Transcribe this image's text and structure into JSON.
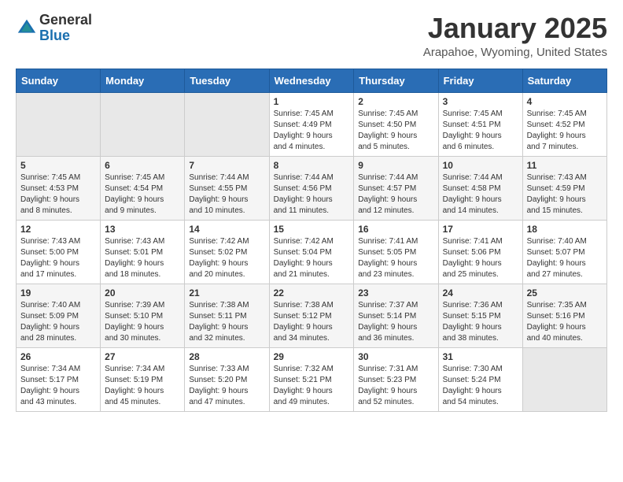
{
  "header": {
    "logo_general": "General",
    "logo_blue": "Blue",
    "month_title": "January 2025",
    "location": "Arapahoe, Wyoming, United States"
  },
  "weekdays": [
    "Sunday",
    "Monday",
    "Tuesday",
    "Wednesday",
    "Thursday",
    "Friday",
    "Saturday"
  ],
  "weeks": [
    [
      {
        "day": "",
        "info": ""
      },
      {
        "day": "",
        "info": ""
      },
      {
        "day": "",
        "info": ""
      },
      {
        "day": "1",
        "info": "Sunrise: 7:45 AM\nSunset: 4:49 PM\nDaylight: 9 hours\nand 4 minutes."
      },
      {
        "day": "2",
        "info": "Sunrise: 7:45 AM\nSunset: 4:50 PM\nDaylight: 9 hours\nand 5 minutes."
      },
      {
        "day": "3",
        "info": "Sunrise: 7:45 AM\nSunset: 4:51 PM\nDaylight: 9 hours\nand 6 minutes."
      },
      {
        "day": "4",
        "info": "Sunrise: 7:45 AM\nSunset: 4:52 PM\nDaylight: 9 hours\nand 7 minutes."
      }
    ],
    [
      {
        "day": "5",
        "info": "Sunrise: 7:45 AM\nSunset: 4:53 PM\nDaylight: 9 hours\nand 8 minutes."
      },
      {
        "day": "6",
        "info": "Sunrise: 7:45 AM\nSunset: 4:54 PM\nDaylight: 9 hours\nand 9 minutes."
      },
      {
        "day": "7",
        "info": "Sunrise: 7:44 AM\nSunset: 4:55 PM\nDaylight: 9 hours\nand 10 minutes."
      },
      {
        "day": "8",
        "info": "Sunrise: 7:44 AM\nSunset: 4:56 PM\nDaylight: 9 hours\nand 11 minutes."
      },
      {
        "day": "9",
        "info": "Sunrise: 7:44 AM\nSunset: 4:57 PM\nDaylight: 9 hours\nand 12 minutes."
      },
      {
        "day": "10",
        "info": "Sunrise: 7:44 AM\nSunset: 4:58 PM\nDaylight: 9 hours\nand 14 minutes."
      },
      {
        "day": "11",
        "info": "Sunrise: 7:43 AM\nSunset: 4:59 PM\nDaylight: 9 hours\nand 15 minutes."
      }
    ],
    [
      {
        "day": "12",
        "info": "Sunrise: 7:43 AM\nSunset: 5:00 PM\nDaylight: 9 hours\nand 17 minutes."
      },
      {
        "day": "13",
        "info": "Sunrise: 7:43 AM\nSunset: 5:01 PM\nDaylight: 9 hours\nand 18 minutes."
      },
      {
        "day": "14",
        "info": "Sunrise: 7:42 AM\nSunset: 5:02 PM\nDaylight: 9 hours\nand 20 minutes."
      },
      {
        "day": "15",
        "info": "Sunrise: 7:42 AM\nSunset: 5:04 PM\nDaylight: 9 hours\nand 21 minutes."
      },
      {
        "day": "16",
        "info": "Sunrise: 7:41 AM\nSunset: 5:05 PM\nDaylight: 9 hours\nand 23 minutes."
      },
      {
        "day": "17",
        "info": "Sunrise: 7:41 AM\nSunset: 5:06 PM\nDaylight: 9 hours\nand 25 minutes."
      },
      {
        "day": "18",
        "info": "Sunrise: 7:40 AM\nSunset: 5:07 PM\nDaylight: 9 hours\nand 27 minutes."
      }
    ],
    [
      {
        "day": "19",
        "info": "Sunrise: 7:40 AM\nSunset: 5:09 PM\nDaylight: 9 hours\nand 28 minutes."
      },
      {
        "day": "20",
        "info": "Sunrise: 7:39 AM\nSunset: 5:10 PM\nDaylight: 9 hours\nand 30 minutes."
      },
      {
        "day": "21",
        "info": "Sunrise: 7:38 AM\nSunset: 5:11 PM\nDaylight: 9 hours\nand 32 minutes."
      },
      {
        "day": "22",
        "info": "Sunrise: 7:38 AM\nSunset: 5:12 PM\nDaylight: 9 hours\nand 34 minutes."
      },
      {
        "day": "23",
        "info": "Sunrise: 7:37 AM\nSunset: 5:14 PM\nDaylight: 9 hours\nand 36 minutes."
      },
      {
        "day": "24",
        "info": "Sunrise: 7:36 AM\nSunset: 5:15 PM\nDaylight: 9 hours\nand 38 minutes."
      },
      {
        "day": "25",
        "info": "Sunrise: 7:35 AM\nSunset: 5:16 PM\nDaylight: 9 hours\nand 40 minutes."
      }
    ],
    [
      {
        "day": "26",
        "info": "Sunrise: 7:34 AM\nSunset: 5:17 PM\nDaylight: 9 hours\nand 43 minutes."
      },
      {
        "day": "27",
        "info": "Sunrise: 7:34 AM\nSunset: 5:19 PM\nDaylight: 9 hours\nand 45 minutes."
      },
      {
        "day": "28",
        "info": "Sunrise: 7:33 AM\nSunset: 5:20 PM\nDaylight: 9 hours\nand 47 minutes."
      },
      {
        "day": "29",
        "info": "Sunrise: 7:32 AM\nSunset: 5:21 PM\nDaylight: 9 hours\nand 49 minutes."
      },
      {
        "day": "30",
        "info": "Sunrise: 7:31 AM\nSunset: 5:23 PM\nDaylight: 9 hours\nand 52 minutes."
      },
      {
        "day": "31",
        "info": "Sunrise: 7:30 AM\nSunset: 5:24 PM\nDaylight: 9 hours\nand 54 minutes."
      },
      {
        "day": "",
        "info": ""
      }
    ]
  ]
}
